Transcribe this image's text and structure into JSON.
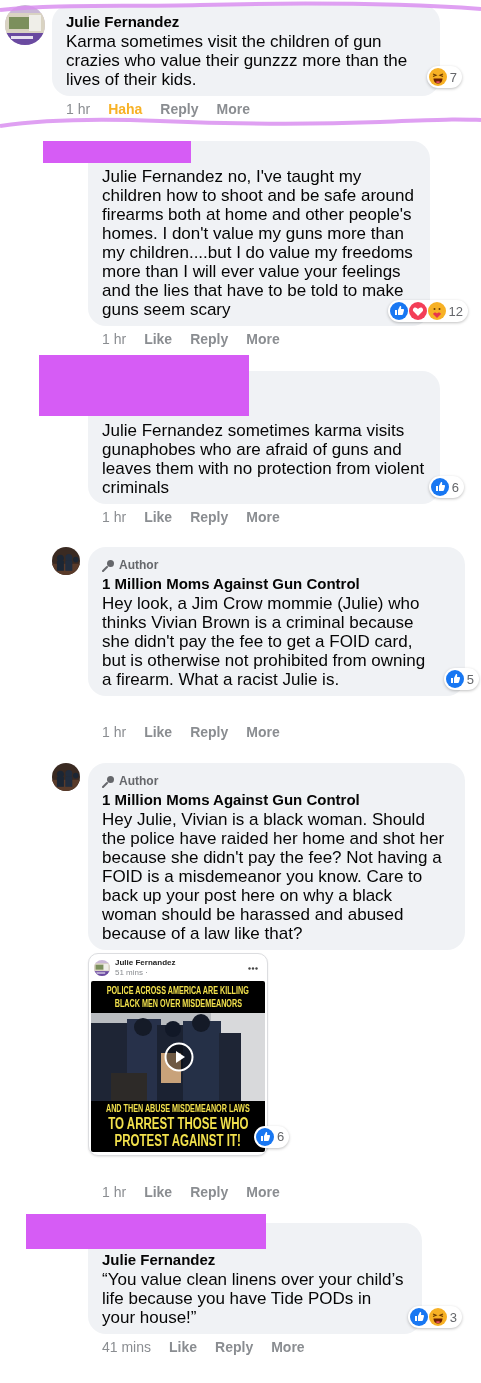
{
  "comments": [
    {
      "kind": "top",
      "has_avatar": true,
      "redacted": false,
      "scribbled": true,
      "author_badge": false,
      "name": "Julie Fernandez",
      "text": "Karma sometimes visit the children of gun crazies who value their gunzzz more than the lives of their kids.",
      "reactions": {
        "icons": [
          {
            "kind": "haha"
          }
        ],
        "count": "7"
      },
      "time": "1 hr",
      "actions": [
        {
          "label": "Haha",
          "selected": true
        },
        {
          "label": "Reply",
          "selected": false
        },
        {
          "label": "More",
          "selected": false
        }
      ]
    },
    {
      "kind": "reply",
      "has_avatar": false,
      "redacted": true,
      "scribbled": false,
      "author_badge": false,
      "text": "Julie Fernandez no, I've taught my children how to shoot and be safe around firearms both at home and other people's homes. I don't value my guns more than my children....but I do value my freedoms more than I will ever value your feelings and the lies that have to be told to make guns seem scary",
      "reactions": {
        "icons": [
          {
            "kind": "like"
          },
          {
            "kind": "love"
          },
          {
            "kind": "care"
          }
        ],
        "count": "12"
      },
      "time": "1 hr",
      "actions": [
        {
          "label": "Like",
          "selected": false
        },
        {
          "label": "Reply",
          "selected": false
        },
        {
          "label": "More",
          "selected": false
        }
      ]
    },
    {
      "kind": "reply",
      "has_avatar": false,
      "redacted": true,
      "scribbled": false,
      "author_badge": false,
      "text": "Julie Fernandez sometimes karma visits gunaphobes who are afraid of guns and leaves them with no protection from violent criminals",
      "reactions": {
        "icons": [
          {
            "kind": "like"
          }
        ],
        "count": "6"
      },
      "time": "1 hr",
      "actions": [
        {
          "label": "Like",
          "selected": false
        },
        {
          "label": "Reply",
          "selected": false
        },
        {
          "label": "More",
          "selected": false
        }
      ]
    },
    {
      "kind": "reply",
      "has_avatar": true,
      "redacted": false,
      "scribbled": false,
      "author_badge": true,
      "badge": "Author",
      "name": "1 Million Moms Against Gun Control",
      "text": "Hey look, a Jim Crow mommie (Julie) who thinks Vivian Brown is a criminal because she didn't pay the fee to get a FOID card, but is otherwise not prohibited from owning a firearm. What a racist Julie is.",
      "reactions": {
        "icons": [
          {
            "kind": "like"
          }
        ],
        "count": "5"
      },
      "time": "1 hr",
      "actions": [
        {
          "label": "Like",
          "selected": false
        },
        {
          "label": "Reply",
          "selected": false
        },
        {
          "label": "More",
          "selected": false
        }
      ]
    },
    {
      "kind": "reply",
      "has_avatar": true,
      "redacted": false,
      "scribbled": false,
      "author_badge": true,
      "badge": "Author",
      "name": "1 Million Moms Against Gun Control",
      "text": "Hey Julie, Vivian is a black woman. Should the police have raided her home and shot her because she didn't pay the fee? Not having a FOID is a misdemeanor you know. Care to back up your post here on why a black woman should be harassed and abused because of a law like that?",
      "attachment": {
        "kind": "shared_post",
        "name": "Julie Fernandez",
        "meta": "51 mins ·",
        "caption_top": [
          "POLICE ACROSS AMERICA ARE KILLING",
          "BLACK MEN OVER MISDEMEANORS"
        ],
        "caption_bottom": [
          "AND THEN ABUSE MISDEMEANOR LAWS",
          "TO ARREST THOSE WHO",
          "PROTEST AGAINST IT!"
        ],
        "reactions": {
          "icons": [
            {
              "kind": "like"
            }
          ],
          "count": "6"
        }
      },
      "time": "1 hr",
      "actions": [
        {
          "label": "Like",
          "selected": false
        },
        {
          "label": "Reply",
          "selected": false
        },
        {
          "label": "More",
          "selected": false
        }
      ]
    },
    {
      "kind": "reply",
      "has_avatar": false,
      "redacted": true,
      "scribbled": false,
      "author_badge": false,
      "name": "Julie Fernandez",
      "text": "“You value clean linens over your child’s life because you have Tide PODs in your house!”",
      "reactions": {
        "icons": [
          {
            "kind": "like"
          },
          {
            "kind": "haha"
          }
        ],
        "count": "3"
      },
      "time": "41 mins",
      "actions": [
        {
          "label": "Like",
          "selected": false
        },
        {
          "label": "Reply",
          "selected": false
        },
        {
          "label": "More",
          "selected": false
        }
      ]
    }
  ]
}
